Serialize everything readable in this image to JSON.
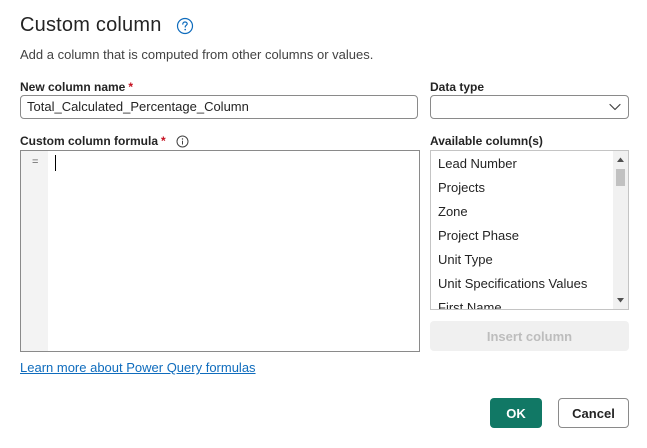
{
  "dialog": {
    "title": "Custom column",
    "subtitle": "Add a column that is computed from other columns or values."
  },
  "new_column": {
    "label": "New column name",
    "required_mark": "*",
    "value": "Total_Calculated_Percentage_Column"
  },
  "data_type": {
    "label": "Data type",
    "selected": ""
  },
  "formula": {
    "label": "Custom column formula",
    "required_mark": "*",
    "gutter_symbol": "=",
    "value": ""
  },
  "available_columns": {
    "label": "Available column(s)",
    "items": [
      "Lead Number",
      "Projects",
      "Zone",
      "Project Phase",
      "Unit Type",
      "Unit Specifications Values",
      "First Name"
    ]
  },
  "buttons": {
    "insert": "Insert column",
    "ok": "OK",
    "cancel": "Cancel"
  },
  "link": {
    "learn_more": "Learn more about Power Query formulas"
  },
  "icons": {
    "help": "help-circle-icon",
    "info": "info-icon",
    "dropdown": "chevron-down-icon"
  },
  "colors": {
    "primary": "#117865",
    "link": "#0f6cbd",
    "required": "#c50f1f"
  }
}
